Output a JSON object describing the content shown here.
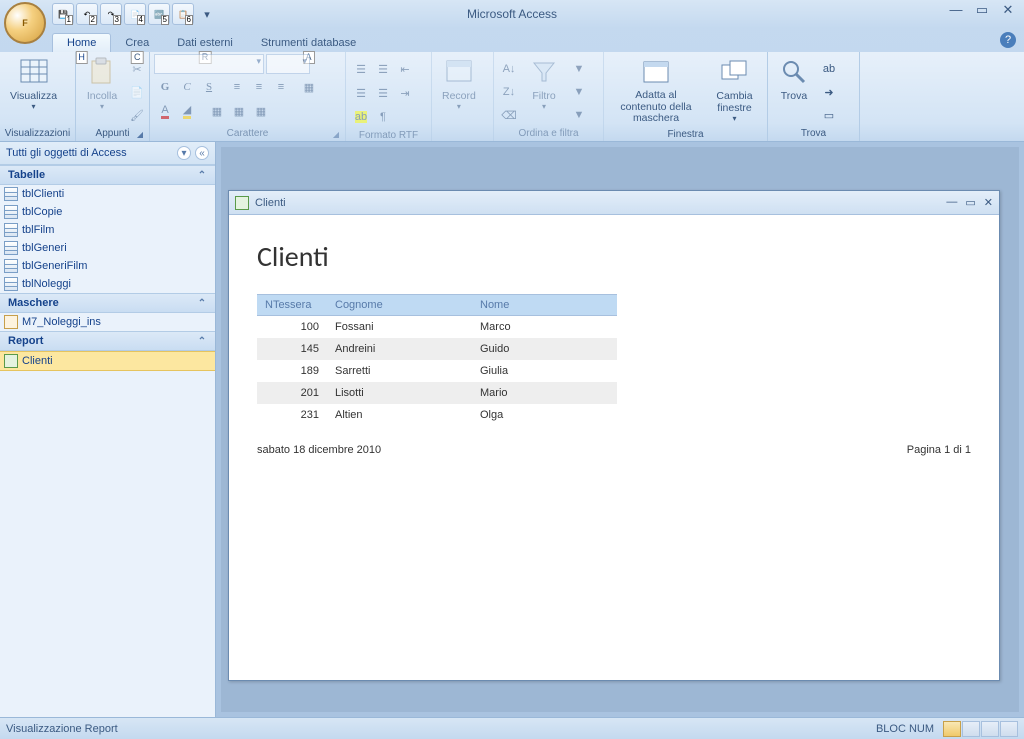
{
  "app_title": "Microsoft Access",
  "qat": [
    "1",
    "2",
    "3",
    "4",
    "5",
    "6"
  ],
  "tabs": {
    "home": {
      "label": "Home",
      "key": "H"
    },
    "crea": {
      "label": "Crea",
      "key": "C"
    },
    "dati": {
      "label": "Dati esterni",
      "key": "R"
    },
    "strumenti": {
      "label": "Strumenti database",
      "key": "A"
    }
  },
  "ribbon": {
    "visualizzazioni": {
      "btn": "Visualizza",
      "label": "Visualizzazioni"
    },
    "appunti": {
      "btn": "Incolla",
      "label": "Appunti"
    },
    "carattere": {
      "label": "Carattere",
      "bold": "G",
      "italic": "C",
      "under": "S"
    },
    "rtf": {
      "label": "Formato RTF"
    },
    "record": {
      "btn": "Record",
      "label": ""
    },
    "ordina": {
      "btn": "Filtro",
      "label": "Ordina e filtra"
    },
    "finestra": {
      "btn1": "Adatta al contenuto della maschera",
      "btn2": "Cambia finestre",
      "label": "Finestra"
    },
    "trova": {
      "btn": "Trova",
      "label": "Trova"
    }
  },
  "navpane": {
    "header": "Tutti gli oggetti di Access",
    "groups": [
      {
        "title": "Tabelle",
        "type": "table",
        "items": [
          "tblClienti",
          "tblCopie",
          "tblFilm",
          "tblGeneri",
          "tblGeneriFilm",
          "tblNoleggi"
        ]
      },
      {
        "title": "Maschere",
        "type": "form",
        "items": [
          "M7_Noleggi_ins"
        ]
      },
      {
        "title": "Report",
        "type": "report",
        "items": [
          "Clienti"
        ],
        "selected": 0
      }
    ]
  },
  "mdi": {
    "title": "Clienti",
    "report_title": "Clienti",
    "columns": [
      "NTessera",
      "Cognome",
      "Nome"
    ],
    "rows": [
      {
        "n": "100",
        "c": "Fossani",
        "no": "Marco"
      },
      {
        "n": "145",
        "c": "Andreini",
        "no": "Guido"
      },
      {
        "n": "189",
        "c": "Sarretti",
        "no": "Giulia"
      },
      {
        "n": "201",
        "c": "Lisotti",
        "no": "Mario"
      },
      {
        "n": "231",
        "c": "Altien",
        "no": "Olga"
      }
    ],
    "footer_date": "sabato 18 dicembre 2010",
    "footer_page": "Pagina 1 di 1"
  },
  "statusbar": {
    "left": "Visualizzazione Report",
    "caps": "BLOC NUM"
  }
}
